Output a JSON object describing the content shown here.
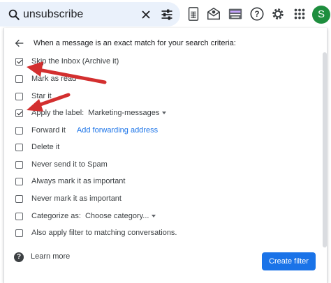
{
  "search": {
    "query": "unsubscribe"
  },
  "icons": {
    "search": "search-icon",
    "clear": "close-icon",
    "tune": "tune-icon",
    "sheets": "sheets-icon",
    "mail_settings": "mail-settings-icon",
    "keyboard": "keyboard-icon",
    "help": "help-icon",
    "settings": "gear-icon",
    "apps": "apps-grid-icon"
  },
  "user": {
    "avatar_initial": "S"
  },
  "dialog": {
    "header": "When a message is an exact match for your search criteria:",
    "options": [
      {
        "label": "Skip the Inbox (Archive it)",
        "checked": true
      },
      {
        "label": "Mark as read",
        "checked": false
      },
      {
        "label": "Star it",
        "checked": false
      },
      {
        "label": "Apply the label:",
        "checked": true,
        "select": "Marketing-messages"
      },
      {
        "label": "Forward it",
        "checked": false,
        "link": "Add forwarding address"
      },
      {
        "label": "Delete it",
        "checked": false
      },
      {
        "label": "Never send it to Spam",
        "checked": false
      },
      {
        "label": "Always mark it as important",
        "checked": false
      },
      {
        "label": "Never mark it as important",
        "checked": false
      },
      {
        "label": "Categorize as:",
        "checked": false,
        "select": "Choose category..."
      },
      {
        "label": "Also apply filter to matching conversations.",
        "checked": false
      }
    ],
    "learn_more": "Learn more",
    "create_button": "Create filter"
  },
  "colors": {
    "accent": "#1a73e8",
    "search_bg": "#eaf1fb",
    "avatar": "#1e8e3e",
    "annotation_arrow": "#d32f2f"
  }
}
